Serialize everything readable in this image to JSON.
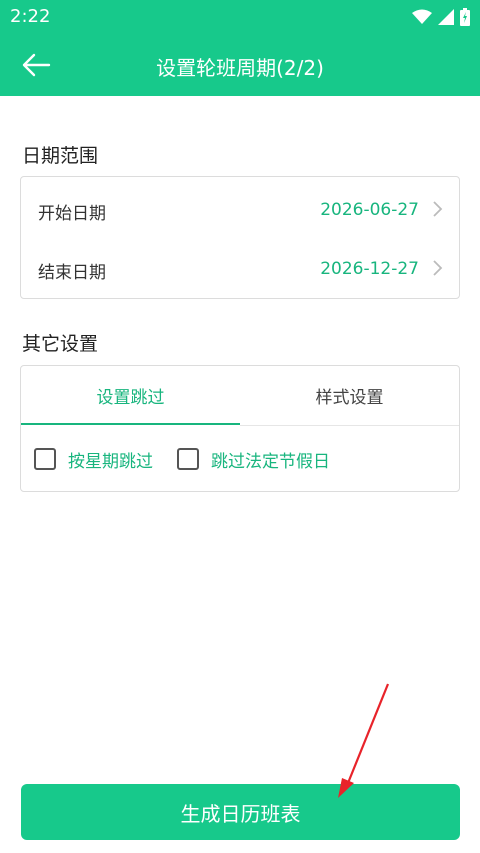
{
  "status_bar": {
    "time": "2:22",
    "icons": [
      "wifi-icon",
      "signal-icon",
      "battery-icon"
    ]
  },
  "header": {
    "back_icon": "arrow-left-icon",
    "title": "设置轮班周期(2/2)"
  },
  "date_range": {
    "section_title": "日期范围",
    "rows": [
      {
        "label": "开始日期",
        "value": "2026-06-27",
        "icon": "chevron-right-icon"
      },
      {
        "label": "结束日期",
        "value": "2026-12-27",
        "icon": "chevron-right-icon"
      }
    ]
  },
  "other_settings": {
    "section_title": "其它设置",
    "tabs": [
      {
        "label": "设置跳过",
        "active": true
      },
      {
        "label": "样式设置",
        "active": false
      }
    ],
    "checkboxes": [
      {
        "label": "按星期跳过",
        "checked": false
      },
      {
        "label": "跳过法定节假日",
        "checked": false
      }
    ]
  },
  "footer": {
    "generate_label": "生成日历班表"
  },
  "colors": {
    "primary": "#17c98b",
    "accent_text": "#18b57e",
    "annotation": "#e8232a"
  }
}
